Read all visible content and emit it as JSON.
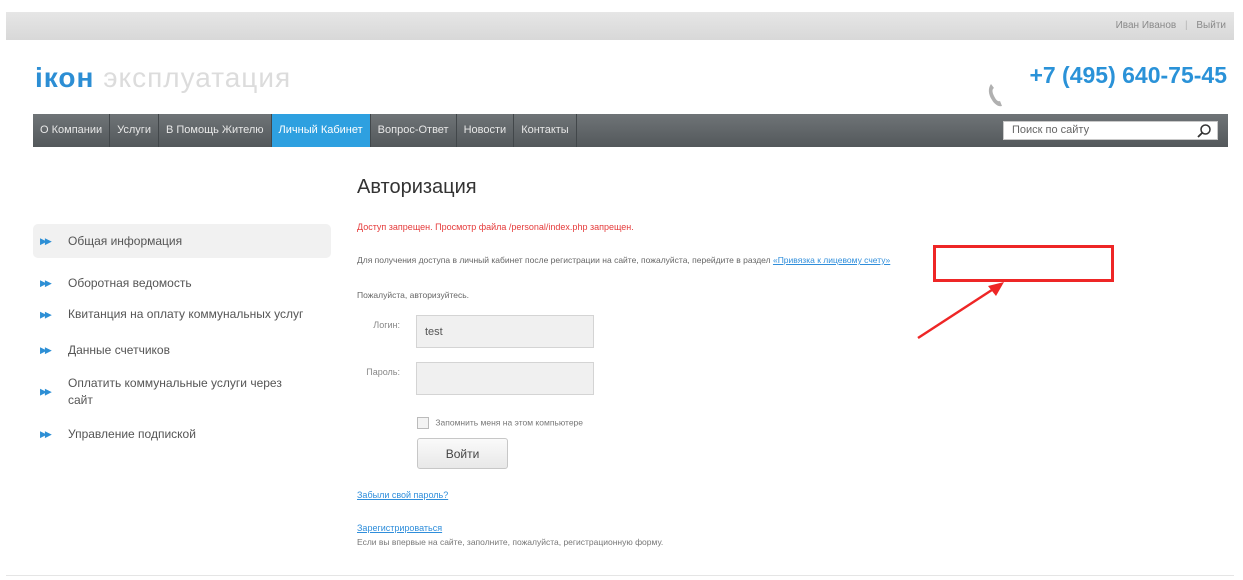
{
  "header": {
    "user_name": "Иван Иванов",
    "logout": "Выйти",
    "logo_brand": "iкон",
    "logo_rest": "эксплуатация",
    "phone": "+7 (495) 640-75-45"
  },
  "nav": {
    "items": [
      {
        "label": "О Компании"
      },
      {
        "label": "Услуги"
      },
      {
        "label": "В Помощь Жителю"
      },
      {
        "label": "Личный Кабинет"
      },
      {
        "label": "Вопрос-Ответ"
      },
      {
        "label": "Новости"
      },
      {
        "label": "Контакты"
      }
    ],
    "active_index": 3,
    "search_placeholder": "Поиск по сайту"
  },
  "sidebar": {
    "items": [
      {
        "label": "Общая информация"
      },
      {
        "label": "Оборотная ведомость"
      },
      {
        "label": "Квитанция на оплату коммунальных услуг"
      },
      {
        "label": "Данные счетчиков"
      },
      {
        "label": "Оплатить коммунальные услуги через сайт"
      },
      {
        "label": "Управление подпиской"
      }
    ]
  },
  "main": {
    "title": "Авторизация",
    "error": "Доступ запрещен. Просмотр файла /personal/index.php запрещен.",
    "info_text": "Для получения доступа в личный кабинет после регистрации на сайте, пожалуйста, перейдите в раздел",
    "info_link": "«Привязка к лицевому счету»",
    "please_auth": "Пожалуйста, авторизуйтесь.",
    "login_label": "Логин:",
    "login_value": "test",
    "password_label": "Пароль:",
    "remember_label": "Запомнить меня на этом компьютере",
    "submit_label": "Войти",
    "forgot_link": "Забыли свой пароль?",
    "register_link": "Зарегистрироваться",
    "register_note": "Если вы впервые на сайте, заполните, пожалуйста, регистрационную форму."
  },
  "colors": {
    "accent": "#2ea0e0",
    "nav_bg": "#5c6164",
    "error": "#e53b3b",
    "annotation": "#ee2626"
  }
}
